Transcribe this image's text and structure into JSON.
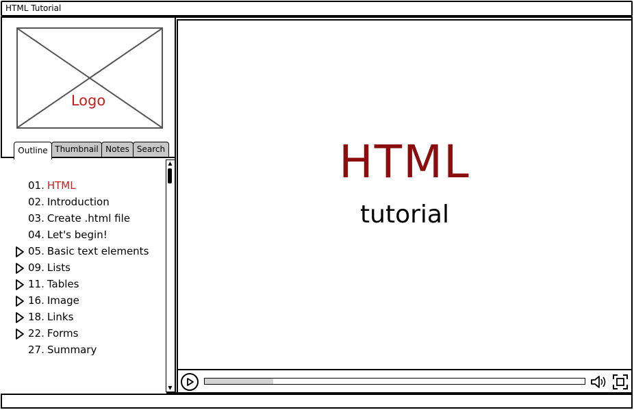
{
  "window": {
    "title": "HTML Tutorial"
  },
  "sidebar": {
    "logo_label": "Logo",
    "tabs": [
      {
        "label": "Outline",
        "active": true
      },
      {
        "label": "Thumbnail",
        "active": false
      },
      {
        "label": "Notes",
        "active": false
      },
      {
        "label": "Search",
        "active": false
      }
    ],
    "outline": [
      {
        "num": "01.",
        "label": "HTML",
        "expandable": false,
        "active": true
      },
      {
        "num": "02.",
        "label": "Introduction",
        "expandable": false,
        "active": false
      },
      {
        "num": "03.",
        "label": "Create .html file",
        "expandable": false,
        "active": false
      },
      {
        "num": "04.",
        "label": "Let's begin!",
        "expandable": false,
        "active": false
      },
      {
        "num": "05.",
        "label": "Basic text elements",
        "expandable": true,
        "active": false
      },
      {
        "num": "09.",
        "label": "Lists",
        "expandable": true,
        "active": false
      },
      {
        "num": "11.",
        "label": "Tables",
        "expandable": true,
        "active": false
      },
      {
        "num": "16.",
        "label": "Image",
        "expandable": true,
        "active": false
      },
      {
        "num": "18.",
        "label": "Links",
        "expandable": true,
        "active": false
      },
      {
        "num": "22.",
        "label": "Forms",
        "expandable": true,
        "active": false
      },
      {
        "num": "27.",
        "label": "Summary",
        "expandable": false,
        "active": false
      }
    ]
  },
  "slide": {
    "title": "HTML",
    "subtitle": "tutorial"
  },
  "player": {
    "progress": 0.18,
    "icons": [
      "play-icon",
      "volume-icon",
      "fullscreen-icon"
    ]
  },
  "colors": {
    "accent": "#c81d1d",
    "slide_title": "#8b0d0d",
    "progress_fill": "#d3d3d3"
  }
}
